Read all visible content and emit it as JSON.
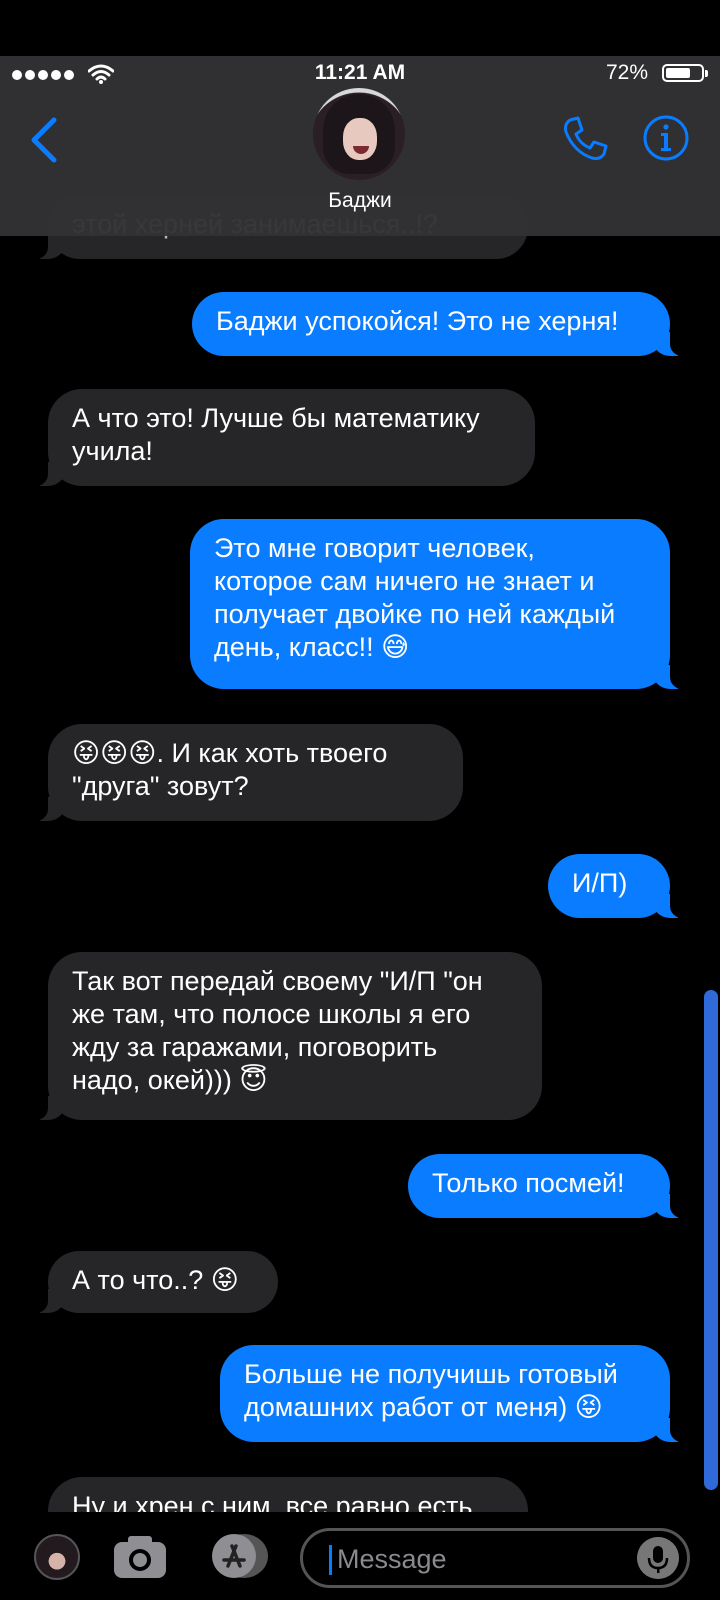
{
  "status_bar": {
    "time": "11:21 AM",
    "battery_percent": "72%",
    "battery_level": 0.72
  },
  "header": {
    "contact_name": "Баджи",
    "back_icon": "chevron-left-icon",
    "call_icon": "phone-icon",
    "info_icon": "info-icon"
  },
  "messages": [
    {
      "side": "in",
      "text": "этой херней занимаешься..!?"
    },
    {
      "side": "out",
      "text": "Баджи успокойся! Это не херня!"
    },
    {
      "side": "in",
      "text": "А что это! Лучше бы математику\nучила!"
    },
    {
      "side": "out",
      "text": "Это мне говорит человек,\nкоторое сам ничего не знает и\nполучает двойке по ней каждый\nдень, класс!! 😅"
    },
    {
      "side": "in",
      "text": "😝😝😝. И как хоть твоего\n\"друга\" зовут?"
    },
    {
      "side": "out",
      "text": "И/П)"
    },
    {
      "side": "in",
      "text": "Так вот передай своему \"И/П \"он\nже там, что полосе школы я его\nжду за гаражами, поговорить\nнадо, окей))) 😇"
    },
    {
      "side": "out",
      "text": "Только посмей!"
    },
    {
      "side": "in",
      "text": "А то что..? 😝"
    },
    {
      "side": "out",
      "text": "Больше не получишь готовый\nдомашних работ от меня) 😝"
    },
    {
      "side": "in",
      "text": "Ну и хрен с ним, все равно есть"
    }
  ],
  "input_bar": {
    "placeholder": "Message",
    "camera_icon": "camera-icon",
    "apps_icon": "app-store-icon",
    "mic_icon": "microphone-icon"
  },
  "colors": {
    "outgoing_bubble": "#0a7cff",
    "incoming_bubble": "#262629",
    "accent": "#0a7cff"
  }
}
